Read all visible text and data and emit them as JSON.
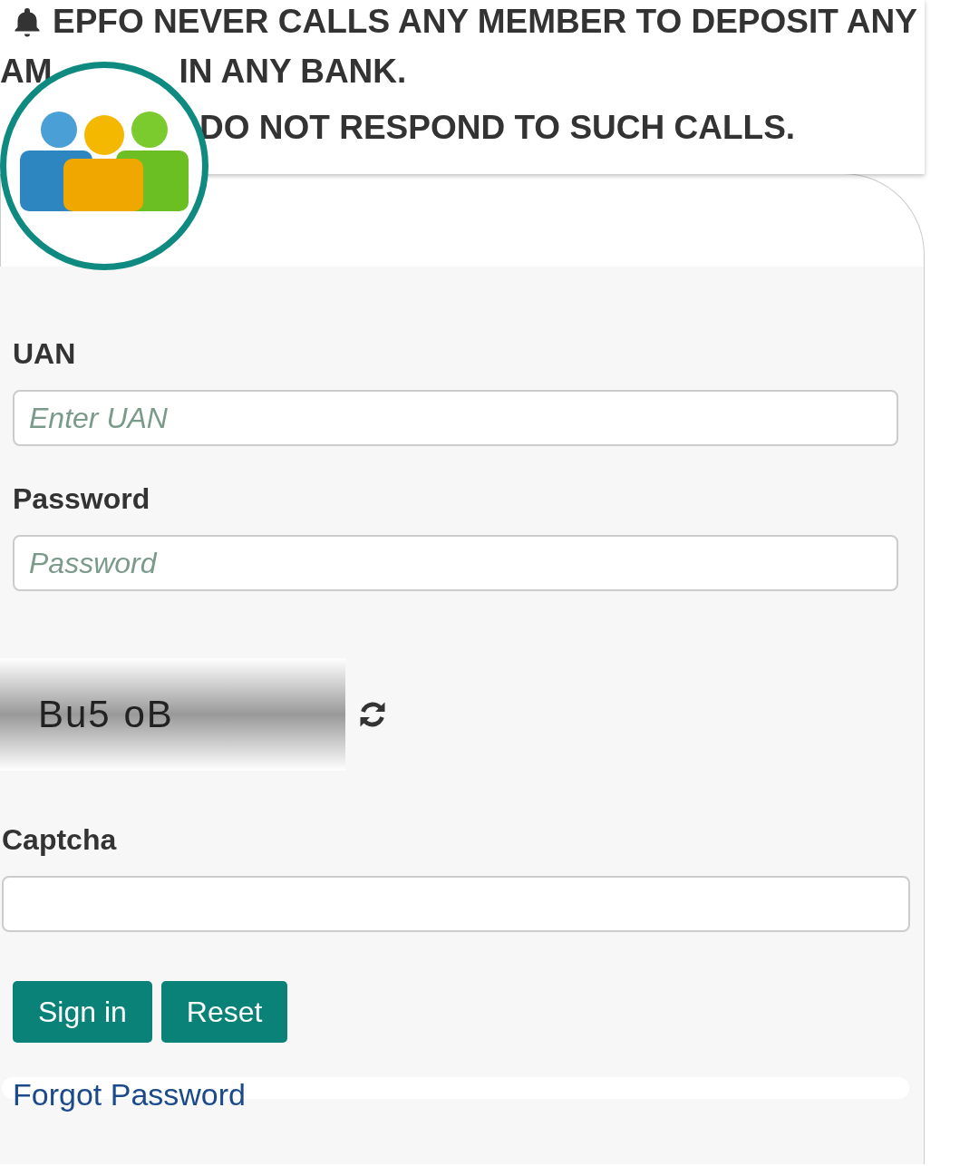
{
  "notice": {
    "line_1": "EPFO NEVER CALLS ANY MEMBER TO DEPOSIT ANY",
    "line_2_start": "AM",
    "line_2_end": "IN ANY BANK.",
    "line_3": "DO NOT RESPOND TO SUCH CALLS."
  },
  "form": {
    "uan": {
      "label": "UAN",
      "placeholder": "Enter UAN"
    },
    "password": {
      "label": "Password",
      "placeholder": "Password"
    },
    "captcha_image": {
      "text": "Bu5 oB"
    },
    "captcha": {
      "label": "Captcha"
    },
    "buttons": [
      "Sign in",
      "Reset"
    ],
    "forgot_link": "Forgot Password"
  }
}
